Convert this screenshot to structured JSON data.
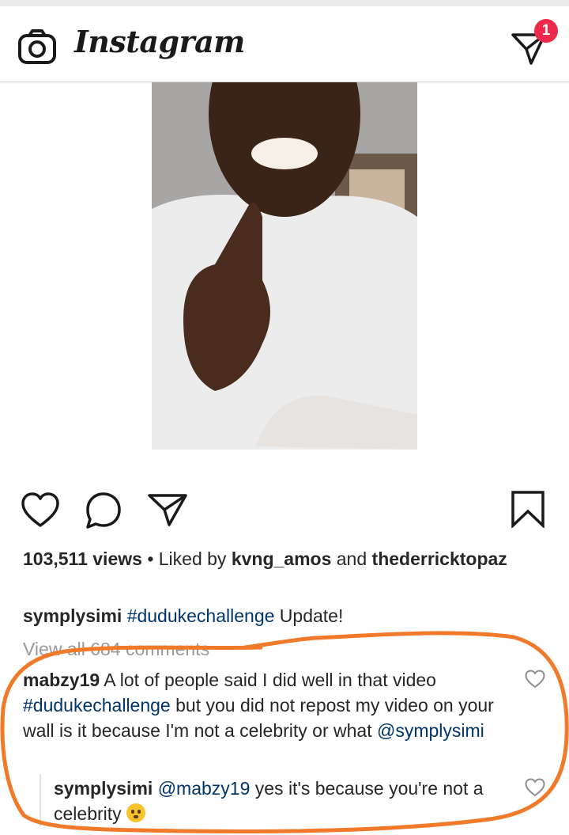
{
  "app": {
    "title": "Instagram",
    "notification_count": "1"
  },
  "post": {
    "views": "103,511 views",
    "liked_by_prefix": "• Liked by",
    "liked_by_user1": "kvng_amos",
    "and": "and",
    "liked_by_user2": "thederricktopaz",
    "caption_user": "symplysimi",
    "caption_tag": "#dudukechallenge",
    "caption_text": "Update!",
    "view_all_comments": "View all 684 comments"
  },
  "comments": [
    {
      "user": "mabzy19",
      "text_a": "A lot of people said I did well in that video",
      "tag": "#dudukechallenge",
      "text_b": "but you did not repost my video on your wall is it because I'm not a celebrity or what",
      "mention": "@symplysimi"
    },
    {
      "user": "symplysimi",
      "mention": "@mabzy19",
      "text": "yes it's because you're not a celebrity",
      "emoji": "hushed-face-emoji"
    }
  ],
  "colors": {
    "annotation": "#f07a2a",
    "hashtag": "#003569",
    "badge": "#ee2a4a",
    "muted": "#999999"
  },
  "icons": [
    "camera-icon",
    "direct-message-icon",
    "heart-icon",
    "comment-icon",
    "share-icon",
    "bookmark-icon"
  ]
}
